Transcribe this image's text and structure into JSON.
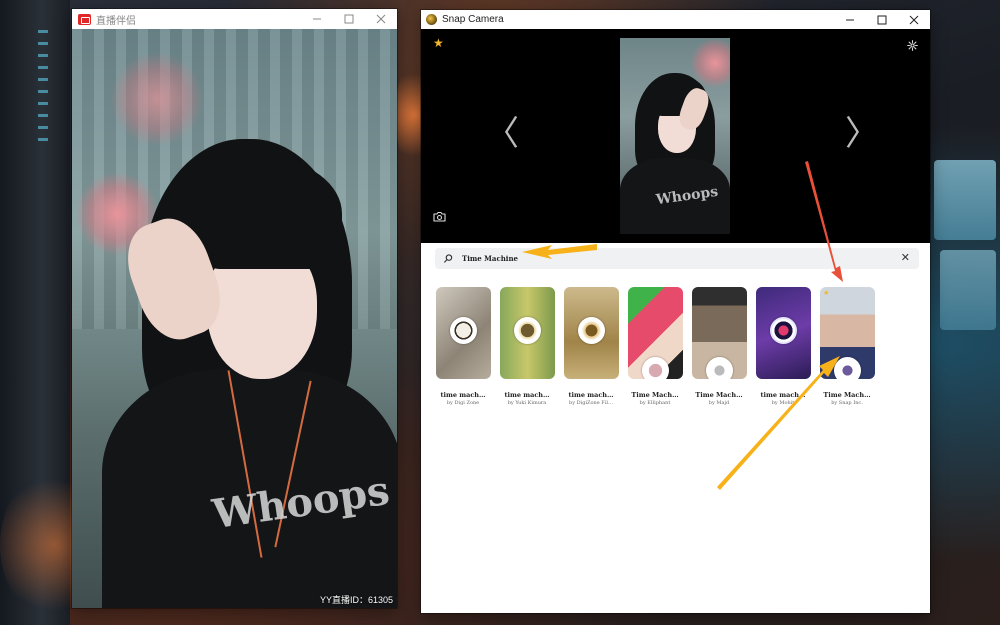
{
  "live_window": {
    "title": "直播伴侣",
    "overlay_text": "YY直播ID：61305"
  },
  "snap_window": {
    "title": "Snap Camera",
    "search": {
      "value": "Time Machine",
      "placeholder": ""
    },
    "lenses": [
      {
        "name": "time mach…",
        "author": "by Digi Zone"
      },
      {
        "name": "time mach…",
        "author": "by Yuki Kimura"
      },
      {
        "name": "time mach…",
        "author": "by DigiZone Fil…"
      },
      {
        "name": "Time Mach…",
        "author": "by Elliphant"
      },
      {
        "name": "Time Mach…",
        "author": "by Majd"
      },
      {
        "name": "time mach…",
        "author": "by Mohit"
      },
      {
        "name": "Time Mach…",
        "author": "by Snap Inc."
      }
    ]
  },
  "colors": {
    "accent_arrow_red": "#e8503a",
    "accent_arrow_orange": "#f7b21a",
    "favorite_star": "#f0b72d"
  },
  "icons": [
    "star-icon",
    "gear-icon",
    "camera-icon",
    "search-icon",
    "close-icon",
    "chevron-left-icon",
    "chevron-right-icon",
    "minimize-icon",
    "maximize-icon"
  ]
}
